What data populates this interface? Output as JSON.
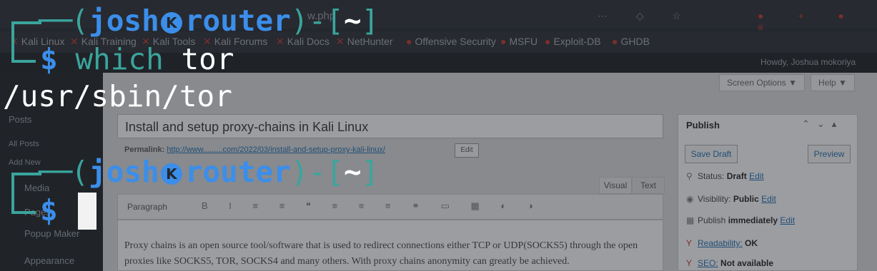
{
  "background": {
    "browser": {
      "url_fragment": "w.php",
      "bookmarks": [
        "Kali Linux",
        "Kali Training",
        "Kali Tools",
        "Kali Forums",
        "Kali Docs",
        "NetHunter",
        "Offensive Security",
        "MSFU",
        "Exploit-DB",
        "GHDB"
      ],
      "toolbar_icons": [
        "more-icon",
        "pocket-icon",
        "star-icon"
      ],
      "extension_icons": [
        "ext-icon",
        "plus-icon",
        "ext-icon",
        "menu-icon"
      ]
    },
    "admin_bar": {
      "howdy": "Howdy, Joshua mokoriya"
    },
    "sidebar": {
      "items": [
        "Posts",
        "All Posts",
        "Add New",
        "Media",
        "Pages",
        "Popup Maker",
        "Appearance"
      ]
    },
    "editor": {
      "screen_options": "Screen Options ▼",
      "help": "Help ▼",
      "post_title": "Install and setup proxy-chains in Kali Linux",
      "permalink_label": "Permalink:",
      "permalink_url": "http://www.........com/2022/03/install-and-setup-proxy-kali-linux/",
      "permalink_edit": "Edit",
      "tab_visual": "Visual",
      "tab_text": "Text",
      "format_select": "Paragraph",
      "body_text": "Proxy chains is an open source tool/software that is used to redirect connections either TCP or UDP(SOCKS5) through the open proxies like SOCKS5, TOR, SOCKS4 and many others. With proxy chains anonymity can greatly be achieved."
    },
    "publish_box": {
      "title": "Publish",
      "save_draft": "Save Draft",
      "preview": "Preview",
      "status_label": "Status:",
      "status_value": "Draft",
      "status_edit": "Edit",
      "visibility_label": "Visibility:",
      "visibility_value": "Public",
      "visibility_edit": "Edit",
      "publish_label": "Publish",
      "publish_value": "immediately",
      "publish_edit": "Edit",
      "readability": "Readability:",
      "readability_value": "OK",
      "seo": "SEO:",
      "seo_value": "Not available"
    }
  },
  "terminal": {
    "prompt1": {
      "open": "(",
      "user": "josh",
      "host": "router",
      "close": ")-[",
      "dir": "~",
      "end": "]"
    },
    "line2": {
      "symbol": "$",
      "cmd": "which",
      "arg": "tor"
    },
    "output": "/usr/sbin/tor",
    "prompt2": {
      "open": "(",
      "user": "josh",
      "host": "router",
      "close": ")-[",
      "dir": "~",
      "end": "]"
    },
    "line4": {
      "symbol": "$"
    },
    "skull_glyph": "K",
    "colors": {
      "teal": "#3aa59d",
      "blue": "#3b8eea",
      "text": "#ffffff",
      "background": "#23272e"
    }
  }
}
